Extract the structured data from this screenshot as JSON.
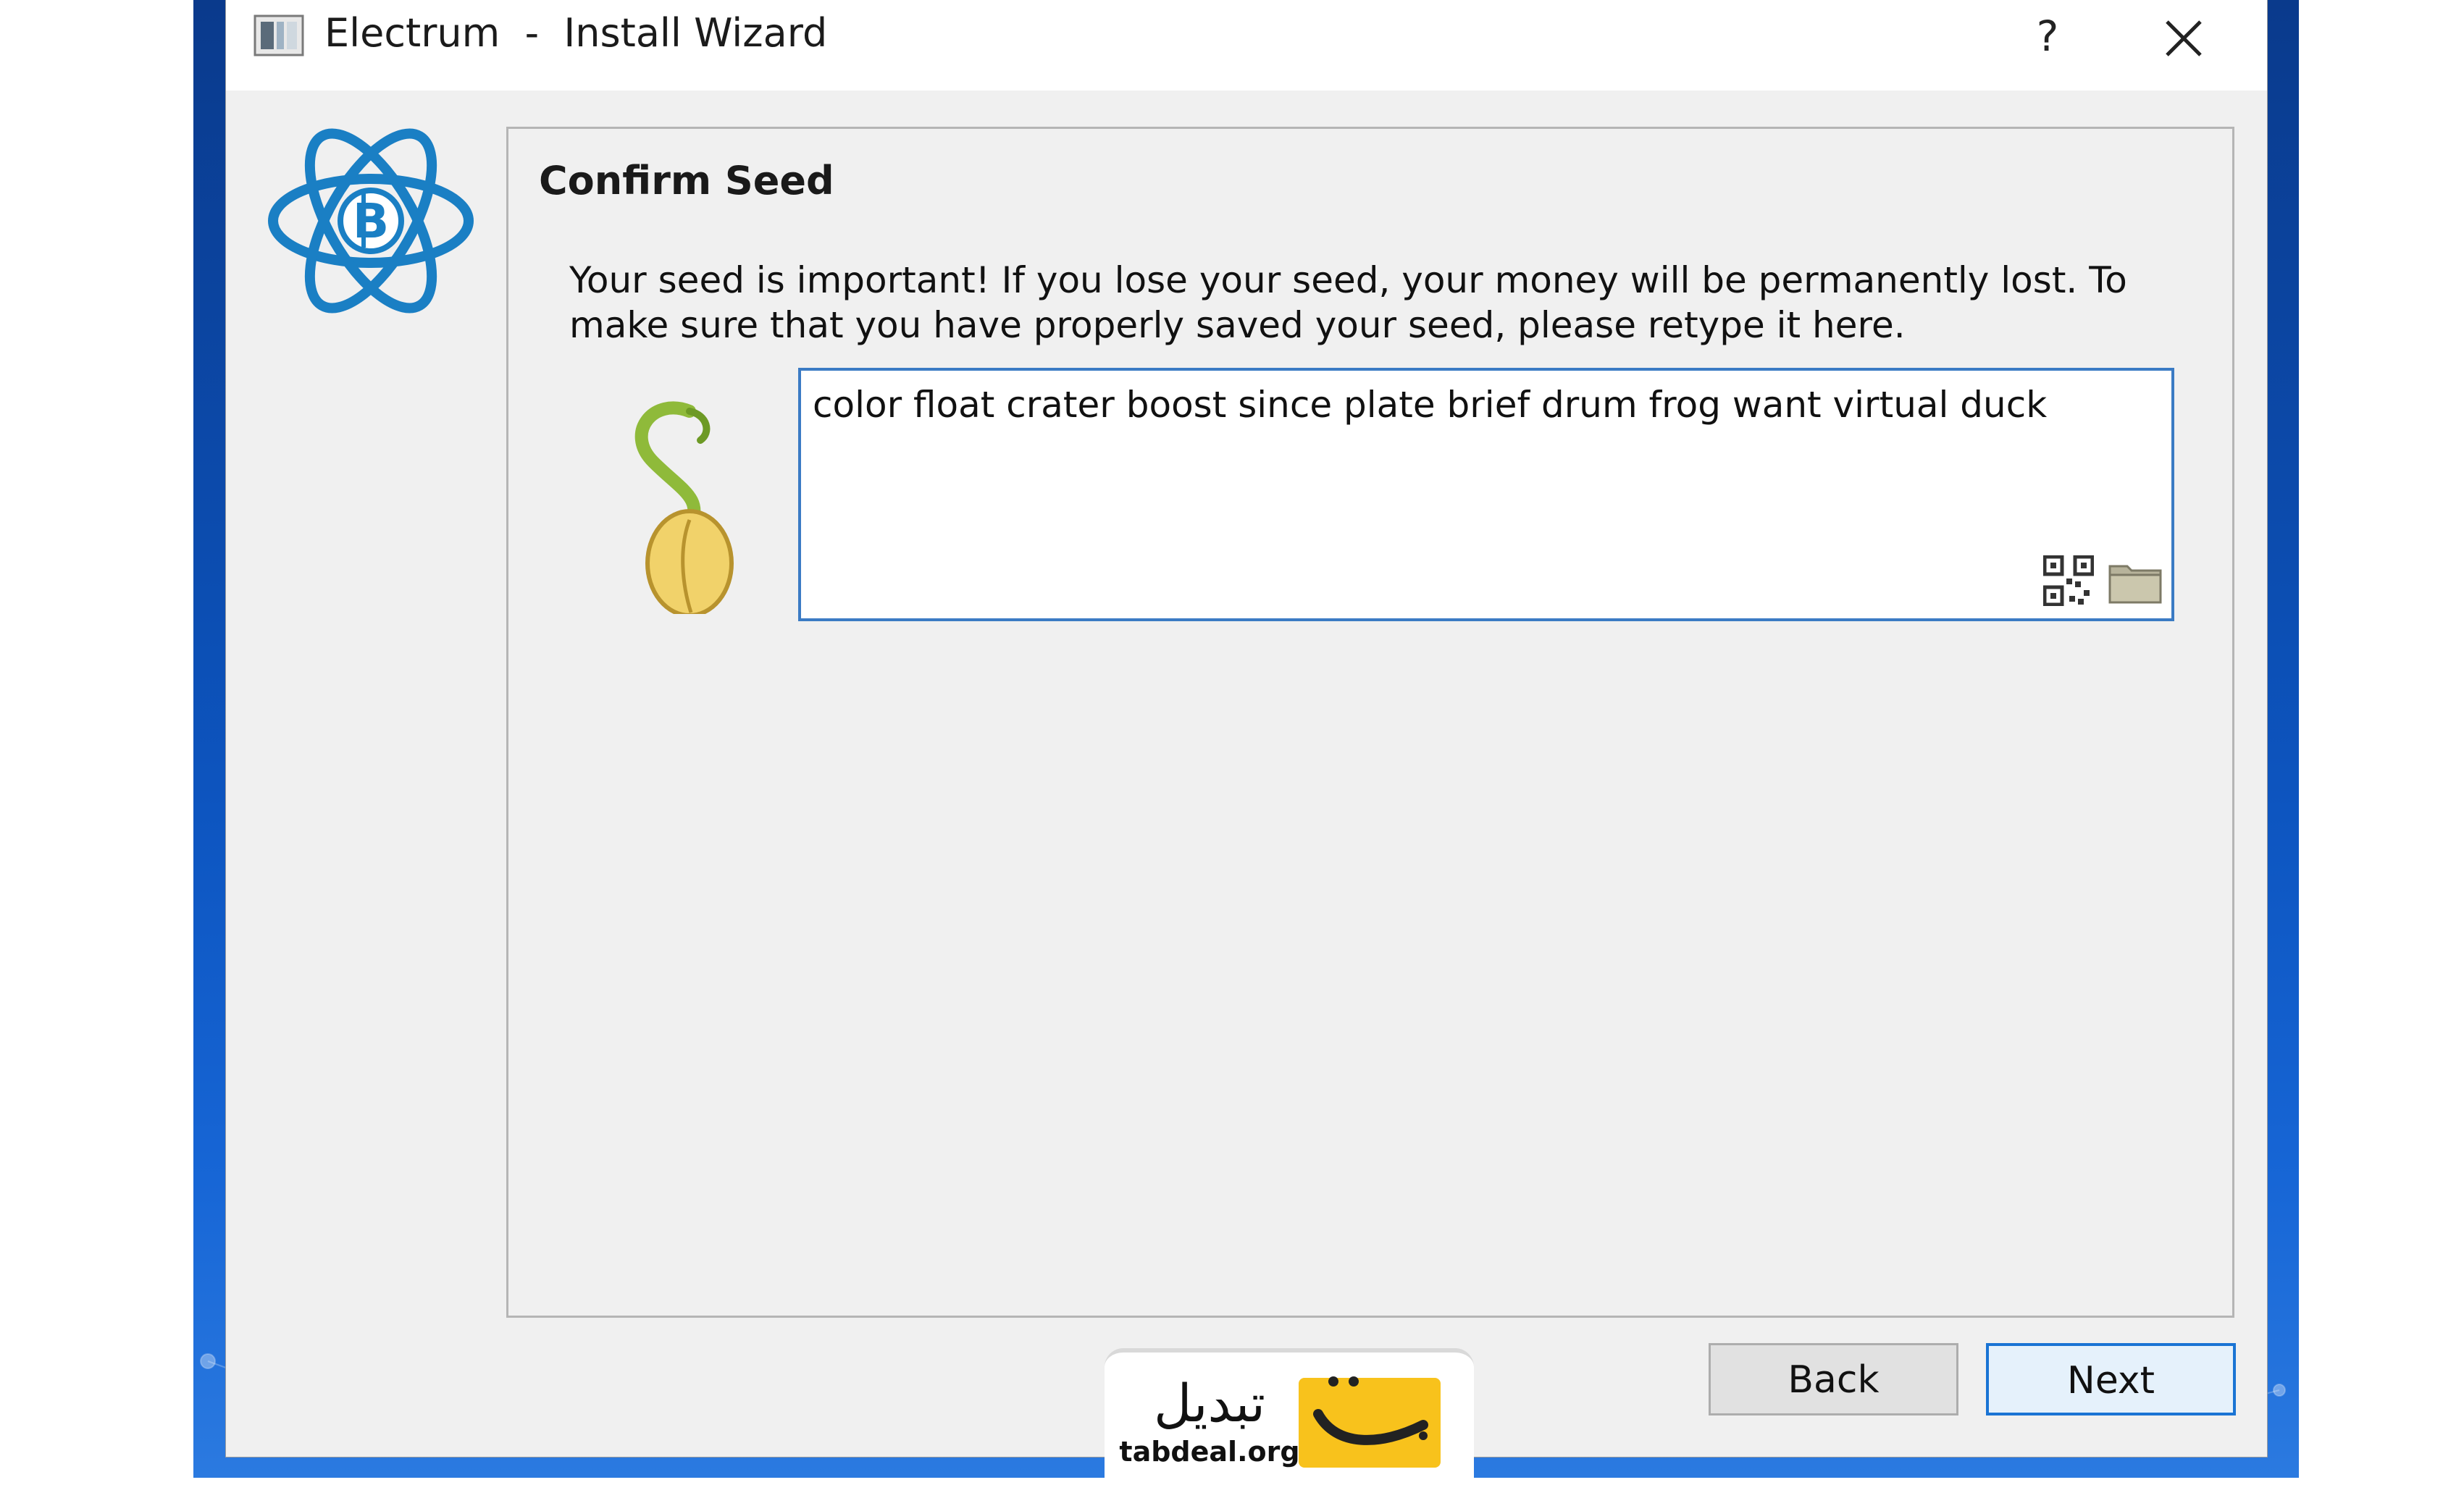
{
  "window": {
    "title": "Electrum  -  Install Wizard",
    "help_label": "?"
  },
  "page": {
    "heading": "Confirm Seed",
    "message": "Your seed is important! If you lose your seed, your money will be permanently lost. To make sure that you have properly saved your seed, please retype it here.",
    "seed_value": "color float crater boost since plate brief drum frog want virtual duck"
  },
  "buttons": {
    "back": "Back",
    "next": "Next"
  },
  "watermark": {
    "brand": "تبدیل",
    "url": "tabdeal.org"
  },
  "icons": {
    "app": "electrum-app-icon",
    "logo": "electrum-atom-bitcoin-logo",
    "seed": "sprouting-seed-icon",
    "qr": "qr-code-icon",
    "folder": "folder-icon",
    "help": "help-icon",
    "close": "close-icon"
  },
  "colors": {
    "accent": "#1a74d4",
    "logo_blue": "#1a7fc4",
    "input_border": "#3b7bc4",
    "watermark_yellow": "#f8c21c"
  }
}
